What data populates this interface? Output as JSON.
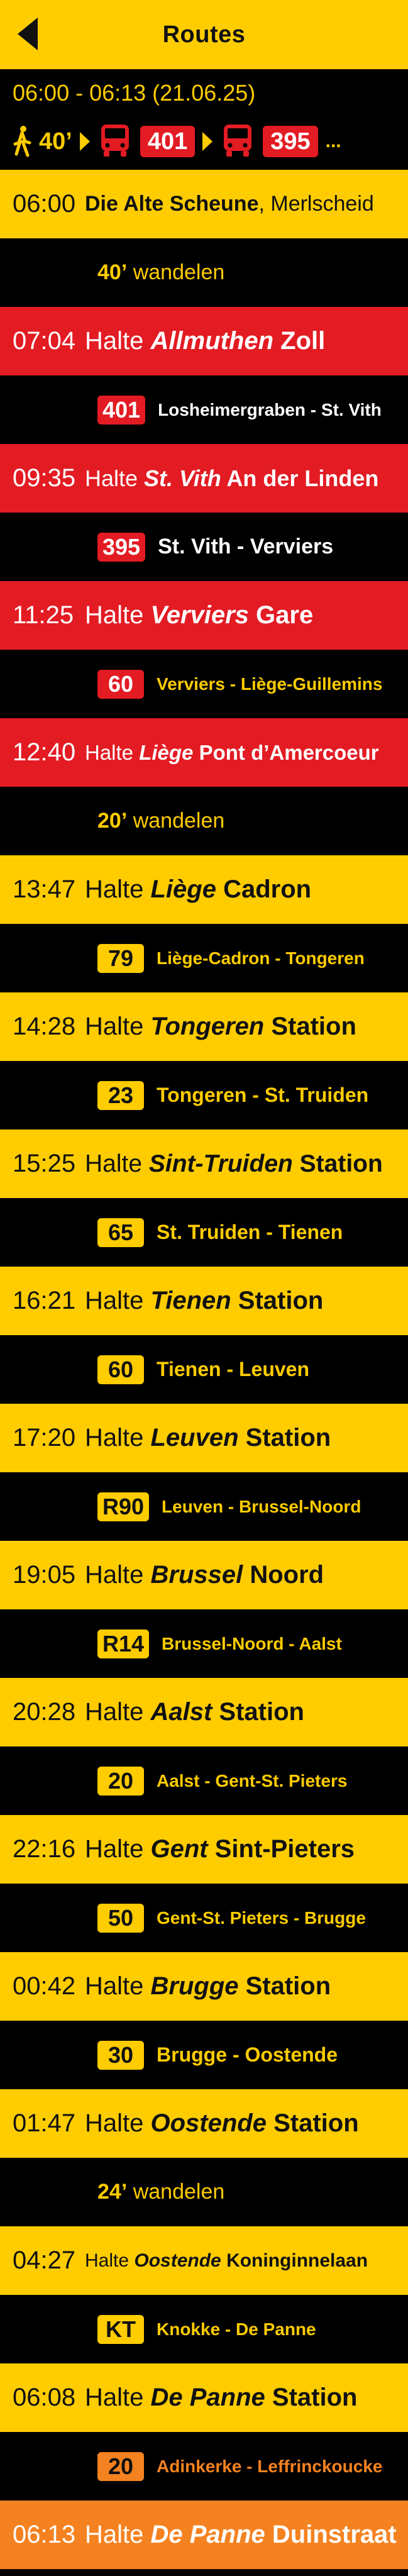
{
  "header": {
    "title": "Routes"
  },
  "summary": {
    "range": "06:00 - 06:13 (21.06.25)",
    "walk": "40’",
    "lines": [
      "401",
      "395"
    ],
    "more": "..."
  },
  "rows": [
    {
      "time": "06:00",
      "kind": "first",
      "name": "Die Alte Scheune",
      "suffix": ", Merlscheid"
    },
    {
      "walk": "40’",
      "walk_label": " wandelen"
    },
    {
      "time": "07:04",
      "prefix": "Halte ",
      "city": "Allmuthen",
      "place": " Zoll"
    },
    {
      "line": "401",
      "route": "Losheimergraben - St. Vith"
    },
    {
      "time": "09:35",
      "prefix": "Halte ",
      "city": "St. Vith",
      "place": " An der Linden"
    },
    {
      "line": "395",
      "route": "St. Vith - Verviers"
    },
    {
      "time": "11:25",
      "prefix": "Halte ",
      "city": "Verviers",
      "place": " Gare"
    },
    {
      "line": "60",
      "route": "Verviers - Liège-Guillemins"
    },
    {
      "time": "12:40",
      "prefix": "Halte ",
      "city": "Liège",
      "place": " Pont d’Amercoeur"
    },
    {
      "walk": "20’",
      "walk_label": " wandelen"
    },
    {
      "time": "13:47",
      "prefix": "Halte ",
      "city": "Liège",
      "place": " Cadron"
    },
    {
      "line": "79",
      "route": "Liège-Cadron - Tongeren"
    },
    {
      "time": "14:28",
      "prefix": "Halte ",
      "city": "Tongeren",
      "place": " Station"
    },
    {
      "line": "23",
      "route": "Tongeren - St. Truiden"
    },
    {
      "time": "15:25",
      "prefix": "Halte ",
      "city": "Sint-Truiden",
      "place": " Station"
    },
    {
      "line": "65",
      "route": "St. Truiden - Tienen"
    },
    {
      "time": "16:21",
      "prefix": "Halte ",
      "city": "Tienen",
      "place": " Station"
    },
    {
      "line": "60",
      "route": "Tienen - Leuven"
    },
    {
      "time": "17:20",
      "prefix": "Halte ",
      "city": "Leuven",
      "place": " Station"
    },
    {
      "line": "R90",
      "route": "Leuven - Brussel-Noord"
    },
    {
      "time": "19:05",
      "prefix": "Halte ",
      "city": "Brussel",
      "place": " Noord"
    },
    {
      "line": "R14",
      "route": "Brussel-Noord - Aalst"
    },
    {
      "time": "20:28",
      "prefix": "Halte ",
      "city": "Aalst",
      "place": " Station"
    },
    {
      "line": "20",
      "route": "Aalst - Gent-St. Pieters"
    },
    {
      "time": "22:16",
      "prefix": "Halte ",
      "city": "Gent",
      "place": " Sint-Pieters"
    },
    {
      "line": "50",
      "route": "Gent-St. Pieters - Brugge"
    },
    {
      "time": "00:42",
      "prefix": "Halte ",
      "city": "Brugge",
      "place": " Station"
    },
    {
      "line": "30",
      "route": "Brugge - Oostende"
    },
    {
      "time": "01:47",
      "prefix": "Halte ",
      "city": "Oostende",
      "place": " Station"
    },
    {
      "walk": "24’",
      "walk_label": " wandelen"
    },
    {
      "time": "04:27",
      "prefix": "Halte ",
      "city": "Oostende",
      "place": " Koninginnelaan"
    },
    {
      "line": "KT",
      "route": "Knokke - De Panne"
    },
    {
      "time": "06:08",
      "prefix": "Halte ",
      "city": "De Panne",
      "place": " Station"
    },
    {
      "line": "20",
      "route": "Adinkerke - Leffrinckoucke"
    },
    {
      "time": "06:13",
      "prefix": "Halte ",
      "city": "De Panne",
      "place": " Duinstraat"
    }
  ],
  "colors": {
    "yellow": "#ffcc00",
    "red": "#e31b23",
    "orange": "#f58220",
    "black": "#000000"
  },
  "icons": {
    "back": "back-arrow-icon",
    "walk": "walking-person-icon",
    "bus": "bus-icon",
    "next": "chevron-right-icon"
  }
}
